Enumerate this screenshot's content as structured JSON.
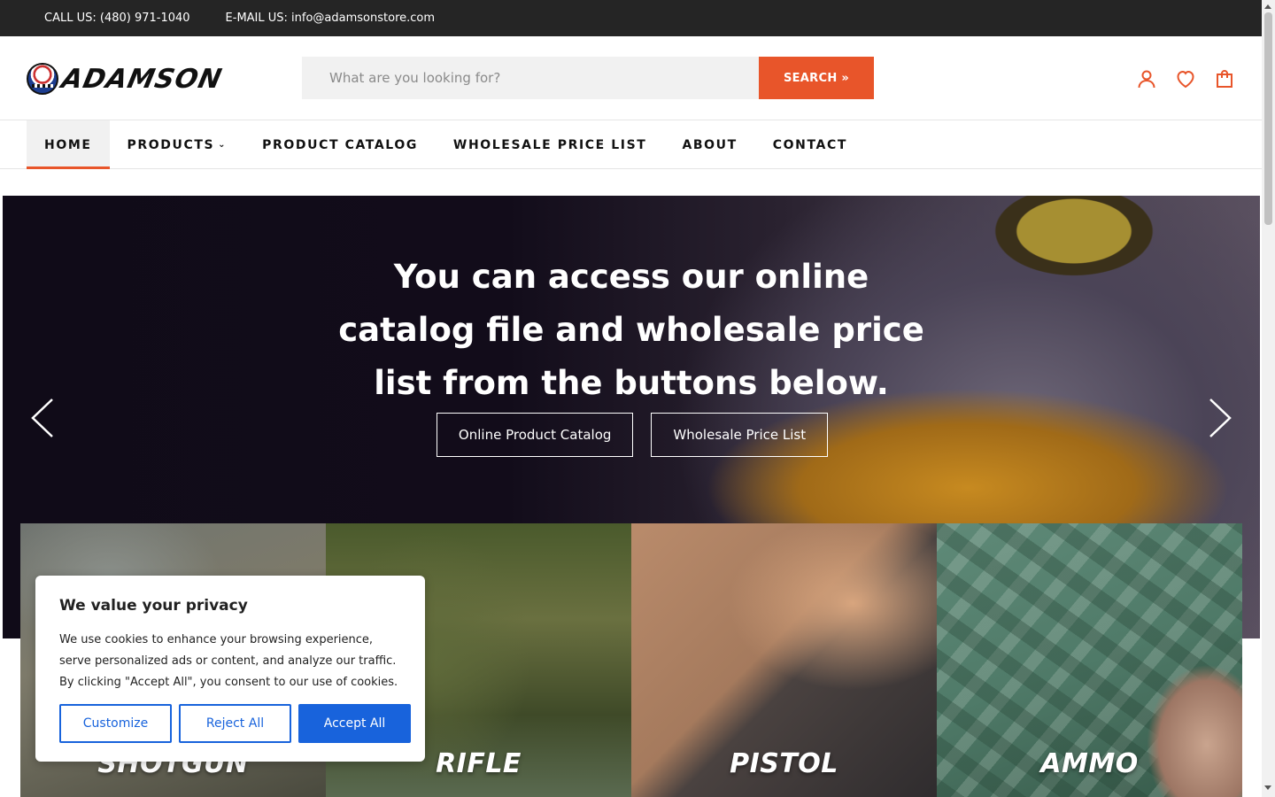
{
  "topbar": {
    "phone": "CALL US: (480) 971-1040",
    "email": "E-MAIL US: info@adamsonstore.com"
  },
  "header": {
    "logo_text": "ADAMSON",
    "search_placeholder": "What are you looking for?",
    "search_button": "SEARCH »",
    "icons": [
      "account-icon",
      "wishlist-heart-icon",
      "cart-bag-icon"
    ]
  },
  "nav": {
    "items": [
      {
        "label": "HOME",
        "active": true
      },
      {
        "label": "PRODUCTS",
        "has_dropdown": true
      },
      {
        "label": "PRODUCT CATALOG"
      },
      {
        "label": "WHOLESALE PRICE LIST"
      },
      {
        "label": "ABOUT"
      },
      {
        "label": "CONTACT"
      }
    ]
  },
  "hero": {
    "title_lines": [
      "You can access our online",
      "catalog file and wholesale price",
      "list from the buttons below."
    ],
    "buttons": [
      "Online Product Catalog",
      "Wholesale Price List"
    ]
  },
  "categories": [
    "SHOTGUN",
    "RIFLE",
    "PISTOL",
    "AMMO"
  ],
  "cookie": {
    "title": "We value your privacy",
    "text": "We use cookies to enhance your browsing experience, serve personalized ads or content, and analyze our traffic. By clicking \"Accept All\", you consent to our use of cookies.",
    "customize": "Customize",
    "reject": "Reject All",
    "accept": "Accept All"
  },
  "colors": {
    "accent": "#e8552a",
    "topbar_bg": "#252525",
    "cookie_blue": "#1863dc"
  }
}
